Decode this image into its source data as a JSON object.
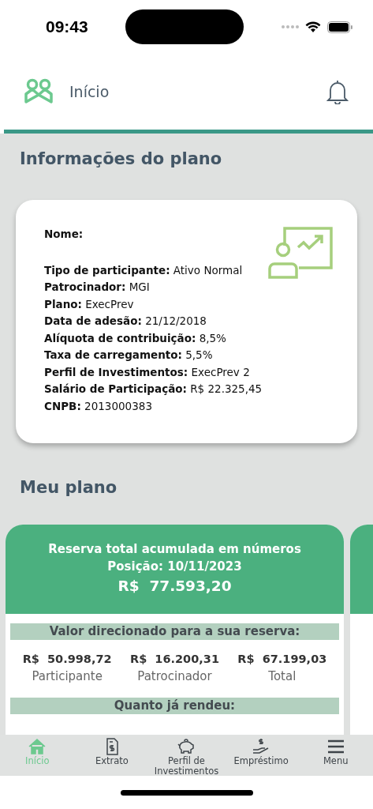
{
  "status_bar": {
    "time": "09:43"
  },
  "header": {
    "title": "Início"
  },
  "info_section": {
    "title": "Informações do plano",
    "fields": [
      {
        "label": "Nome:"
      },
      {
        "label": "Tipo de participante:",
        "value": "Ativo Normal"
      },
      {
        "label": "Patrocinador:",
        "value": "MGI"
      },
      {
        "label": "Plano:",
        "value": "ExecPrev"
      },
      {
        "label": "Data de adesão:",
        "value": "21/12/2018"
      },
      {
        "label": "Alíquota de contribuição:",
        "value": "8,5%"
      },
      {
        "label": "Taxa de carregamento:",
        "value": "5,5%"
      },
      {
        "label": "Perfil de Investimentos:",
        "value": "ExecPrev 2"
      },
      {
        "label": "Salário de Participação:",
        "value": "R$ 22.325,45"
      },
      {
        "label": "CNPB:",
        "value": "2013000383"
      }
    ]
  },
  "plan_section": {
    "title": "Meu plano",
    "card": {
      "title": "Reserva total acumulada em números",
      "position": "Posição: 10/11/2023",
      "total": "R$  77.593,20",
      "contributions_heading": "Valor direcionado para a sua reserva:",
      "contributions": [
        {
          "amount": "R$  50.998,72",
          "label": "Participante"
        },
        {
          "amount": "R$  16.200,31",
          "label": "Patrocinador"
        },
        {
          "amount": "R$  67.199,03",
          "label": "Total"
        }
      ],
      "yield_heading": "Quanto já rendeu:"
    }
  },
  "tab_bar": [
    {
      "kind": "home",
      "label": "Início",
      "selected": true
    },
    {
      "kind": "statement",
      "label": "Extrato",
      "selected": false
    },
    {
      "kind": "piggy",
      "label": "Perfil de Investimentos",
      "selected": false
    },
    {
      "kind": "loan",
      "label": "Empréstimo",
      "selected": false
    },
    {
      "kind": "menu",
      "label": "Menu",
      "selected": false
    }
  ]
}
